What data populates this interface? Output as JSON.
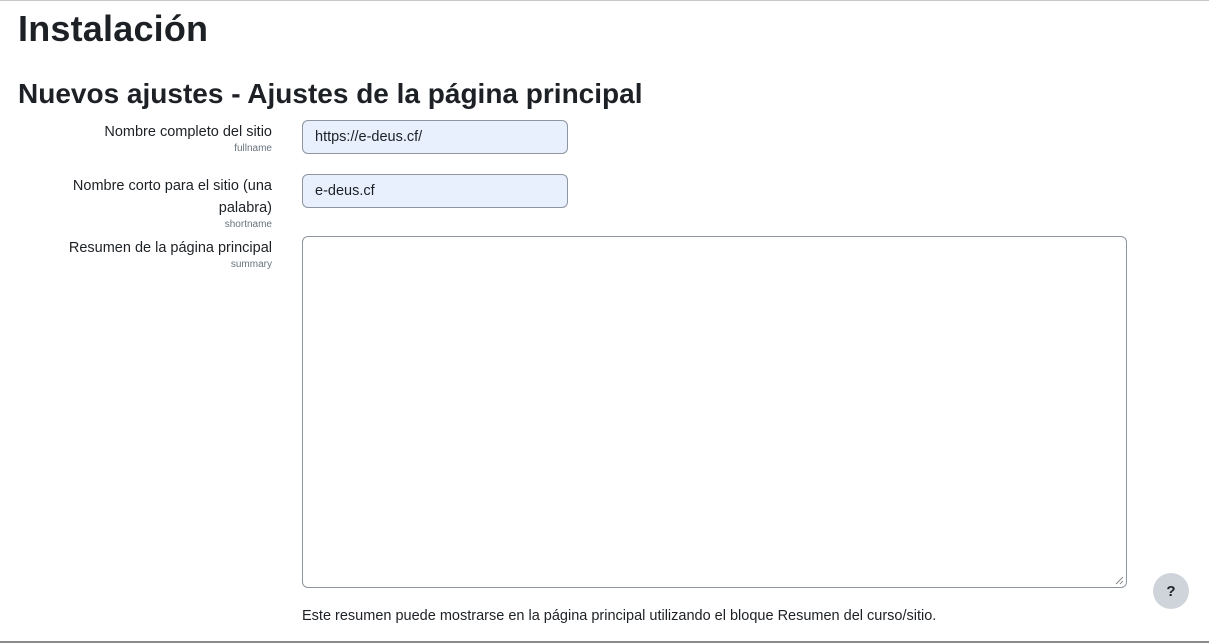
{
  "page": {
    "title": "Instalación",
    "section_title": "Nuevos ajustes - Ajustes de la página principal"
  },
  "fields": {
    "fullname": {
      "label": "Nombre completo del sitio",
      "name": "fullname",
      "value": "https://e-deus.cf/"
    },
    "shortname": {
      "label_line1": "Nombre corto para el sitio (una",
      "label_line2": "palabra)",
      "name": "shortname",
      "value": "e-deus.cf"
    },
    "summary": {
      "label": "Resumen de la página principal",
      "name": "summary",
      "value": "",
      "description": "Este resumen puede mostrarse en la página principal utilizando el bloque Resumen del curso/sitio."
    }
  },
  "help_button": {
    "label": "?"
  },
  "icons": {
    "help": "question-mark-icon",
    "resize": "resize-grip-icon"
  },
  "colors": {
    "autofill_background": "#e8f0fe",
    "help_button_background": "#ced4da",
    "text": "#1d2125",
    "muted_text": "#6a737b"
  }
}
